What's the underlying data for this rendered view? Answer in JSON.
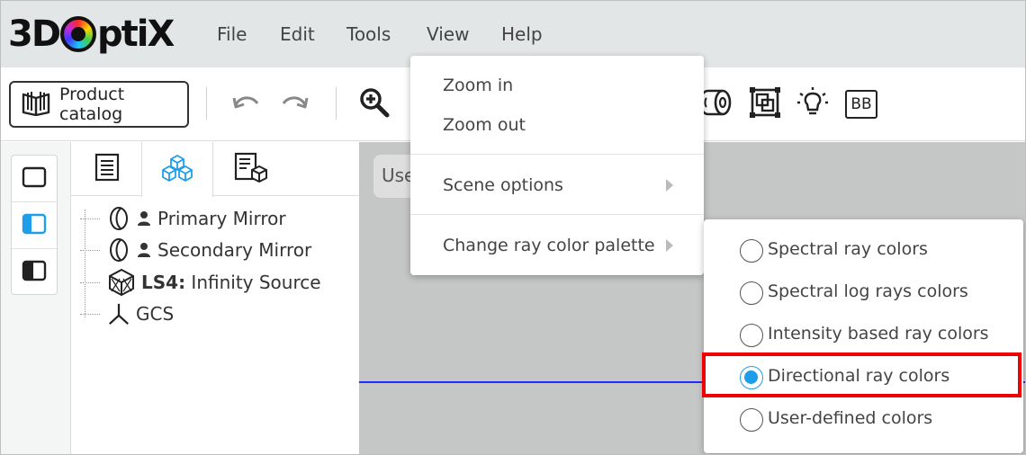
{
  "app": {
    "logo_text_left": "3D",
    "logo_text_right": "ptiX"
  },
  "menubar": {
    "items": [
      "File",
      "Edit",
      "Tools",
      "View",
      "Help"
    ]
  },
  "toolbar": {
    "catalog_label": "Product catalog",
    "icons": [
      "book-icon",
      "undo-icon",
      "redo-icon",
      "zoom-in-icon",
      "roll-icon",
      "group-icon",
      "bulb-icon",
      "bb-icon"
    ],
    "bb_label": "BB"
  },
  "left_strip": {
    "buttons": [
      "layout-none-icon",
      "layout-left-panel-icon",
      "layout-split-icon"
    ],
    "active_index": 1
  },
  "tree_panel": {
    "tabs": [
      "list-icon",
      "cubes-icon",
      "doc-cube-icon"
    ],
    "active_tab": 1,
    "items": [
      {
        "label_bold": "",
        "label": "Primary Mirror",
        "icon": "mirror-icon",
        "user": true
      },
      {
        "label_bold": "",
        "label": "Secondary Mirror",
        "icon": "mirror-icon",
        "user": true
      },
      {
        "label_bold": "LS4:",
        "label": " Infinity Source",
        "icon": "source-cube-icon",
        "user": false
      },
      {
        "label_bold": "",
        "label": "GCS",
        "icon": "axes-icon",
        "user": false
      }
    ]
  },
  "viewport": {
    "chip_label": "Use",
    "ray_color": "#1f2bff"
  },
  "view_menu": {
    "items": [
      {
        "label": "Zoom in",
        "submenu": false
      },
      {
        "label": "Zoom out",
        "submenu": false
      },
      {
        "label": "Scene options",
        "submenu": true
      },
      {
        "label": "Change ray color palette",
        "submenu": true
      }
    ]
  },
  "ray_palette_menu": {
    "options": [
      "Spectral ray colors",
      "Spectral log rays colors",
      "Intensity based ray colors",
      "Directional ray colors",
      "User-defined colors"
    ],
    "selected_index": 3,
    "highlight_color": "#ef0000",
    "accent_color": "#1e9ee8"
  }
}
